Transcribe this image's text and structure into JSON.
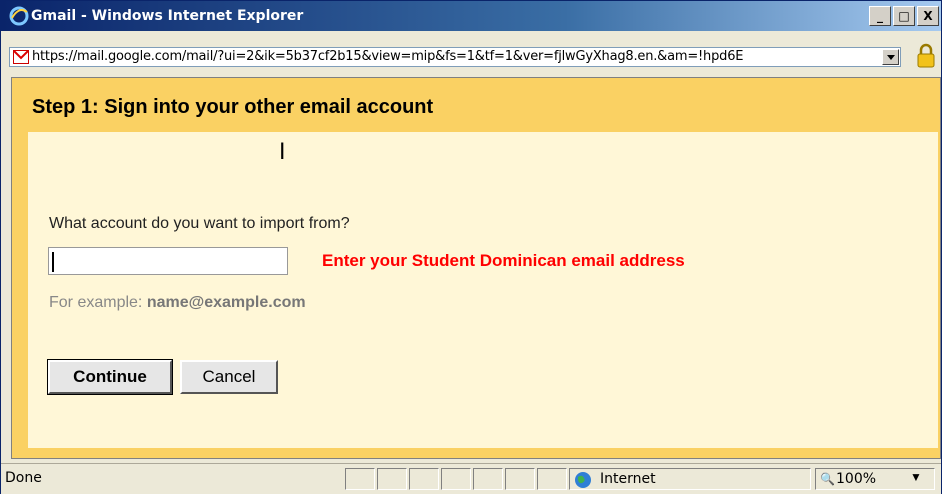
{
  "window": {
    "title": "Gmail - Windows Internet Explorer",
    "min_glyph": "_",
    "max_glyph": "□",
    "close_glyph": "X"
  },
  "address": {
    "url": "https://mail.google.com/mail/?ui=2&ik=5b37cf2b15&view=mip&fs=1&tf=1&ver=fjlwGyXhag8.en.&am=!hpd6E"
  },
  "dialog": {
    "title": "Step 1: Sign into your other email account",
    "question": "What account do you want to import from?",
    "email_value": "",
    "hint": "Enter your Student Dominican email address",
    "example_prefix": "For example: ",
    "example_value": "name@example.com",
    "continue_label": "Continue",
    "cancel_label": "Cancel"
  },
  "status": {
    "text": "Done",
    "zone": "Internet",
    "zoom": "100%"
  },
  "colors": {
    "title_bar": "#0a246a",
    "panel_border": "#fad163",
    "panel_bg": "#fff7d7",
    "hint": "#ff0000"
  },
  "icons": [
    "ie-icon",
    "gmail-icon",
    "dropdown-arrow-icon",
    "lock-icon",
    "globe-icon",
    "zoom-icon",
    "text-cursor-icon"
  ]
}
